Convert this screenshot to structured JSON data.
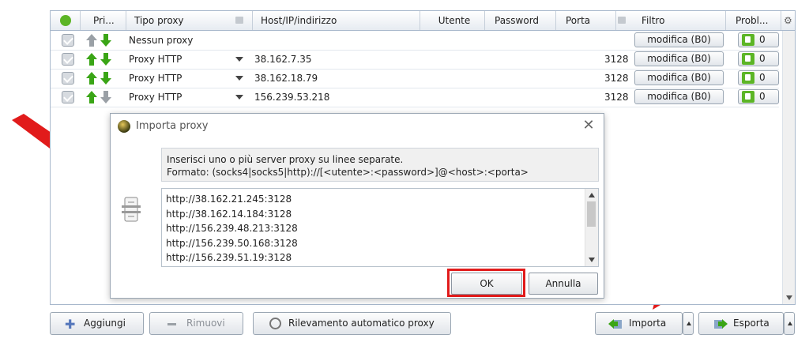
{
  "table": {
    "columns": [
      "Pri...",
      "Tipo proxy",
      "Host/IP/indirizzo",
      "Utente",
      "Password",
      "Porta",
      "Filtro",
      "Probl..."
    ],
    "rows": [
      {
        "type": "Nessun proxy",
        "host": "",
        "port": "",
        "filter": "modifica (B0)",
        "problems": "0"
      },
      {
        "type": "Proxy HTTP",
        "host": "38.162.7.35",
        "port": "3128",
        "filter": "modifica (B0)",
        "problems": "0"
      },
      {
        "type": "Proxy HTTP",
        "host": "38.162.18.79",
        "port": "3128",
        "filter": "modifica (B0)",
        "problems": "0"
      },
      {
        "type": "Proxy HTTP",
        "host": "156.239.53.218",
        "port": "3128",
        "filter": "modifica (B0)",
        "problems": "0"
      }
    ]
  },
  "dialog": {
    "title": "Importa proxy",
    "close_label": "✕",
    "instruction_line1": "Inserisci uno o più server proxy su linee separate.",
    "instruction_line2": "Formato: (socks4|socks5|http)://[<utente>:<password>]@<host>:<porta>",
    "proxy_lines": [
      "http://38.162.21.245:3128",
      "http://38.162.14.184:3128",
      "http://156.239.48.213:3128",
      "http://156.239.50.168:3128",
      "http://156.239.51.19:3128"
    ],
    "ok_label": "OK",
    "cancel_label": "Annulla"
  },
  "toolbar": {
    "add_label": "Aggiungi",
    "remove_label": "Rimuovi",
    "autodetect_label": "Rilevamento automatico proxy",
    "import_label": "Importa",
    "export_label": "Esporta"
  },
  "colors": {
    "highlight_red": "#e11b1b",
    "arrow_green": "#3aa516",
    "thumb_green": "#5cb526"
  },
  "icons": [
    "check-header-icon",
    "lock-icon",
    "gear-icon",
    "arrow-up-icon",
    "arrow-down-icon",
    "thumbs-up-icon",
    "import-icon",
    "export-icon",
    "plus-icon",
    "minus-icon",
    "globe-icon"
  ]
}
